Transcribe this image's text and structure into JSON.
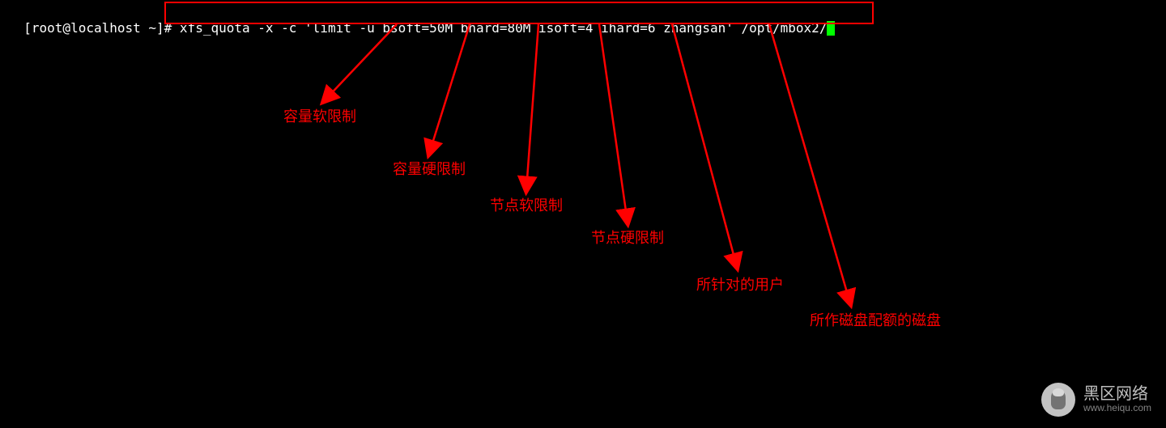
{
  "terminal": {
    "prompt": "[root@localhost ~]# ",
    "command": "xfs_quota -x -c 'limit -u bsoft=50M bhard=80M isoft=4 ihard=6 zhangsan' /opt/mbox2/"
  },
  "labels": {
    "bsoft": "容量软限制",
    "bhard": "容量硬限制",
    "isoft": "节点软限制",
    "ihard": "节点硬限制",
    "user": "所针对的用户",
    "disk": "所作磁盘配额的磁盘"
  },
  "watermark": {
    "title": "黑区网络",
    "url": "www.heiqu.com"
  }
}
